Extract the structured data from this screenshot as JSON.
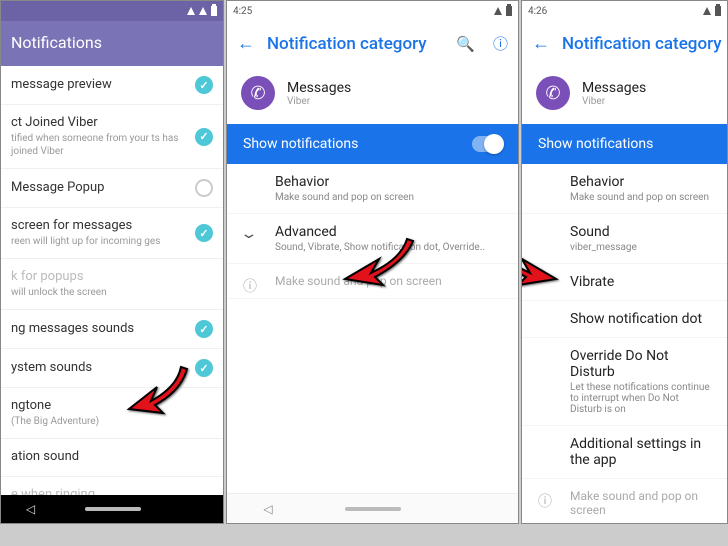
{
  "panel1": {
    "header": "Notifications",
    "items": [
      {
        "title": "message preview",
        "sub": "",
        "checked": true
      },
      {
        "title": "ct Joined Viber",
        "sub": "tified when someone from your\nts has joined Viber",
        "checked": true
      },
      {
        "title": "Message Popup",
        "sub": "",
        "checked": false
      },
      {
        "title": "screen for messages",
        "sub": "reen will light up for incoming\nges",
        "checked": true
      },
      {
        "title": "k for popups",
        "sub": "will unlock the screen",
        "disabled": true
      },
      {
        "title": "ng messages sounds",
        "sub": "",
        "checked": true
      },
      {
        "title": "ystem sounds",
        "sub": "",
        "checked": true
      },
      {
        "title": "ngtone",
        "sub": "(The Big Adventure)"
      },
      {
        "title": "ation sound",
        "sub": ""
      },
      {
        "title": "e when ringing",
        "sub": "",
        "disabled": true
      }
    ]
  },
  "panel2": {
    "time": "4:25",
    "header": "Notification category",
    "app_name": "Messages",
    "app_sub": "Viber",
    "show_label": "Show notifications",
    "items": [
      {
        "title": "Behavior",
        "sub": "Make sound and pop on screen"
      },
      {
        "title": "Advanced",
        "sub": "Sound, Vibrate, Show notification dot, Override..",
        "chev": true
      },
      {
        "title": "Make sound and pop on screen",
        "info": true
      }
    ]
  },
  "panel3": {
    "time": "4:26",
    "header": "Notification category",
    "app_name": "Messages",
    "app_sub": "Viber",
    "show_label": "Show notifications",
    "items": [
      {
        "title": "Behavior",
        "sub": "Make sound and pop on screen"
      },
      {
        "title": "Sound",
        "sub": "viber_message"
      },
      {
        "title": "Vibrate",
        "sub": ""
      },
      {
        "title": "Show notification dot",
        "sub": ""
      },
      {
        "title": "Override Do Not Disturb",
        "sub": "Let these notifications continue to interrupt when Do Not Disturb is on"
      },
      {
        "title": "Additional settings in the app",
        "sub": ""
      },
      {
        "title": "Make sound and pop on screen",
        "info": true
      }
    ]
  }
}
